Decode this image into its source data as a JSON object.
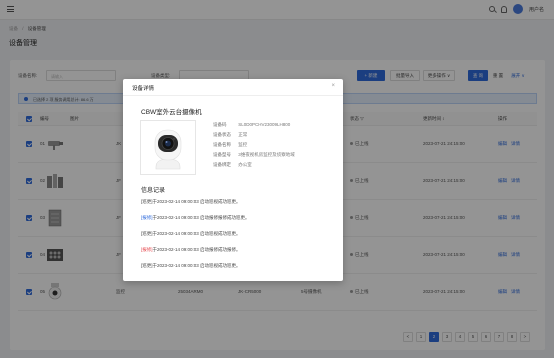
{
  "topbar": {
    "username": "用户名"
  },
  "breadcrumb": {
    "parent": "设备",
    "separator": "/",
    "current": "设备管理"
  },
  "page": {
    "title": "设备管理"
  },
  "filters": {
    "name_label": "设备名称:",
    "name_placeholder": "请输入",
    "type_label": "设备类型:",
    "new_button": "+ 新建",
    "batch_import": "批量导入",
    "more_ops": "更多操作 ∨",
    "search_button": "查 询",
    "reset_button": "重 置",
    "expand": "展开 ∨"
  },
  "info_bar": {
    "text": "已选择 2 项   服务调用总计: 86.6 万"
  },
  "table": {
    "headers": {
      "index": "编号",
      "image": "图片",
      "status": "状态 ▽",
      "updated": "更新时间 ↕",
      "ops": "操作"
    },
    "rows": [
      {
        "index": "01",
        "code": "JK",
        "status": "已上线",
        "updated": "2023-07-21 24:15:00",
        "edit": "编辑",
        "detail": "详情"
      },
      {
        "index": "02",
        "code": "JF",
        "status": "已上线",
        "updated": "2023-07-21 24:15:00",
        "edit": "编辑",
        "detail": "详情"
      },
      {
        "index": "03",
        "code": "JF",
        "status": "已上线",
        "updated": "2023-07-21 24:15:00",
        "edit": "编辑",
        "detail": "详情"
      },
      {
        "index": "04",
        "code": "JF",
        "status": "已上线",
        "updated": "2023-07-21 24:15:00",
        "edit": "编辑",
        "detail": "详情"
      },
      {
        "index": "05",
        "code": "监控",
        "serial": "25034ARM0",
        "model": "JK-CR5000",
        "type": "5号摄像机",
        "status": "已上线",
        "updated": "2023-07-21 24:15:00",
        "edit": "编辑",
        "detail": "详情"
      }
    ]
  },
  "pagination": {
    "prev": "<",
    "pages": [
      "1",
      "2",
      "3",
      "4",
      "5",
      "6",
      "7",
      "8"
    ],
    "active": "2",
    "next": ">"
  },
  "modal": {
    "title": "设备详情",
    "close": "×",
    "device_name": "CBW室外云台摄像机",
    "fields": [
      {
        "key": "设备码",
        "value": "SL0D0PCHV23009LH800"
      },
      {
        "key": "设备状态",
        "value": "正常"
      },
      {
        "key": "设备名称",
        "value": "监控"
      },
      {
        "key": "设备型号",
        "value": "3维夜视机房监控及侦察地域"
      },
      {
        "key": "设备绑定",
        "value": "办公室"
      }
    ],
    "log_title": "信息记录",
    "logs": [
      {
        "tag": "[巡更]",
        "tag_color": "#444444",
        "text": "于2023-02-14 09:00:03 启动巡视成功巡更。"
      },
      {
        "tag": "[报修]",
        "tag_color": "#2f6bdc",
        "text": "于2023-02-14 09:00:03 启动报修报修成功巡更。"
      },
      {
        "tag": "[巡更]",
        "tag_color": "#444444",
        "text": "于2023-02-14 09:00:03 启动巡视成功巡更。"
      },
      {
        "tag": "[报修]",
        "tag_color": "#e5484d",
        "text": "于2023-02-14 09:00:03 启动报修成功报修。"
      },
      {
        "tag": "[巡更]",
        "tag_color": "#444444",
        "text": "于2023-02-14 09:00:03 启动巡视成功巡更。"
      }
    ]
  },
  "colors": {
    "primary": "#2f6bdc",
    "danger": "#e5484d",
    "overlay": "rgba(0,0,0,0.42)"
  }
}
